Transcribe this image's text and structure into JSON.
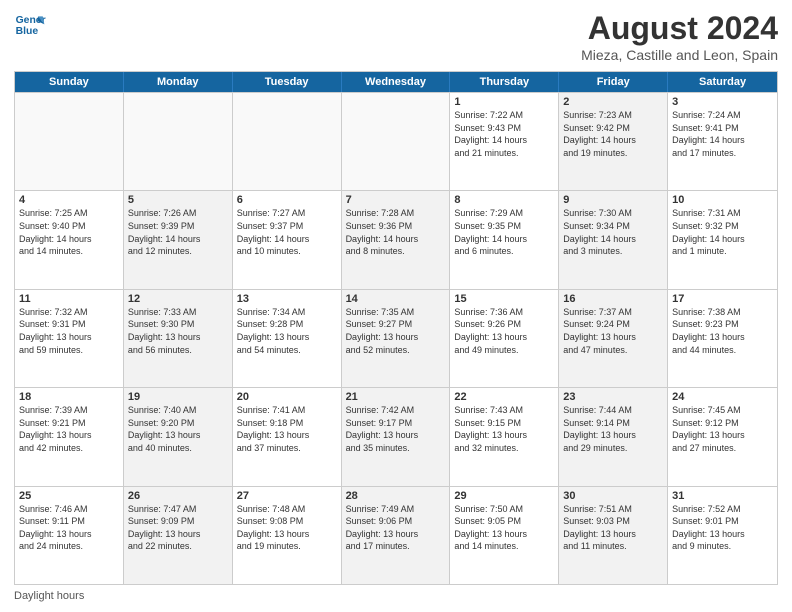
{
  "logo": {
    "line1": "General",
    "line2": "Blue"
  },
  "title": "August 2024",
  "subtitle": "Mieza, Castille and Leon, Spain",
  "days_of_week": [
    "Sunday",
    "Monday",
    "Tuesday",
    "Wednesday",
    "Thursday",
    "Friday",
    "Saturday"
  ],
  "weeks": [
    [
      {
        "day": "",
        "info": "",
        "empty": true
      },
      {
        "day": "",
        "info": "",
        "empty": true
      },
      {
        "day": "",
        "info": "",
        "empty": true
      },
      {
        "day": "",
        "info": "",
        "empty": true
      },
      {
        "day": "1",
        "info": "Sunrise: 7:22 AM\nSunset: 9:43 PM\nDaylight: 14 hours\nand 21 minutes."
      },
      {
        "day": "2",
        "info": "Sunrise: 7:23 AM\nSunset: 9:42 PM\nDaylight: 14 hours\nand 19 minutes.",
        "shaded": true
      },
      {
        "day": "3",
        "info": "Sunrise: 7:24 AM\nSunset: 9:41 PM\nDaylight: 14 hours\nand 17 minutes."
      }
    ],
    [
      {
        "day": "4",
        "info": "Sunrise: 7:25 AM\nSunset: 9:40 PM\nDaylight: 14 hours\nand 14 minutes."
      },
      {
        "day": "5",
        "info": "Sunrise: 7:26 AM\nSunset: 9:39 PM\nDaylight: 14 hours\nand 12 minutes.",
        "shaded": true
      },
      {
        "day": "6",
        "info": "Sunrise: 7:27 AM\nSunset: 9:37 PM\nDaylight: 14 hours\nand 10 minutes."
      },
      {
        "day": "7",
        "info": "Sunrise: 7:28 AM\nSunset: 9:36 PM\nDaylight: 14 hours\nand 8 minutes.",
        "shaded": true
      },
      {
        "day": "8",
        "info": "Sunrise: 7:29 AM\nSunset: 9:35 PM\nDaylight: 14 hours\nand 6 minutes."
      },
      {
        "day": "9",
        "info": "Sunrise: 7:30 AM\nSunset: 9:34 PM\nDaylight: 14 hours\nand 3 minutes.",
        "shaded": true
      },
      {
        "day": "10",
        "info": "Sunrise: 7:31 AM\nSunset: 9:32 PM\nDaylight: 14 hours\nand 1 minute."
      }
    ],
    [
      {
        "day": "11",
        "info": "Sunrise: 7:32 AM\nSunset: 9:31 PM\nDaylight: 13 hours\nand 59 minutes."
      },
      {
        "day": "12",
        "info": "Sunrise: 7:33 AM\nSunset: 9:30 PM\nDaylight: 13 hours\nand 56 minutes.",
        "shaded": true
      },
      {
        "day": "13",
        "info": "Sunrise: 7:34 AM\nSunset: 9:28 PM\nDaylight: 13 hours\nand 54 minutes."
      },
      {
        "day": "14",
        "info": "Sunrise: 7:35 AM\nSunset: 9:27 PM\nDaylight: 13 hours\nand 52 minutes.",
        "shaded": true
      },
      {
        "day": "15",
        "info": "Sunrise: 7:36 AM\nSunset: 9:26 PM\nDaylight: 13 hours\nand 49 minutes."
      },
      {
        "day": "16",
        "info": "Sunrise: 7:37 AM\nSunset: 9:24 PM\nDaylight: 13 hours\nand 47 minutes.",
        "shaded": true
      },
      {
        "day": "17",
        "info": "Sunrise: 7:38 AM\nSunset: 9:23 PM\nDaylight: 13 hours\nand 44 minutes."
      }
    ],
    [
      {
        "day": "18",
        "info": "Sunrise: 7:39 AM\nSunset: 9:21 PM\nDaylight: 13 hours\nand 42 minutes."
      },
      {
        "day": "19",
        "info": "Sunrise: 7:40 AM\nSunset: 9:20 PM\nDaylight: 13 hours\nand 40 minutes.",
        "shaded": true
      },
      {
        "day": "20",
        "info": "Sunrise: 7:41 AM\nSunset: 9:18 PM\nDaylight: 13 hours\nand 37 minutes."
      },
      {
        "day": "21",
        "info": "Sunrise: 7:42 AM\nSunset: 9:17 PM\nDaylight: 13 hours\nand 35 minutes.",
        "shaded": true
      },
      {
        "day": "22",
        "info": "Sunrise: 7:43 AM\nSunset: 9:15 PM\nDaylight: 13 hours\nand 32 minutes."
      },
      {
        "day": "23",
        "info": "Sunrise: 7:44 AM\nSunset: 9:14 PM\nDaylight: 13 hours\nand 29 minutes.",
        "shaded": true
      },
      {
        "day": "24",
        "info": "Sunrise: 7:45 AM\nSunset: 9:12 PM\nDaylight: 13 hours\nand 27 minutes."
      }
    ],
    [
      {
        "day": "25",
        "info": "Sunrise: 7:46 AM\nSunset: 9:11 PM\nDaylight: 13 hours\nand 24 minutes."
      },
      {
        "day": "26",
        "info": "Sunrise: 7:47 AM\nSunset: 9:09 PM\nDaylight: 13 hours\nand 22 minutes.",
        "shaded": true
      },
      {
        "day": "27",
        "info": "Sunrise: 7:48 AM\nSunset: 9:08 PM\nDaylight: 13 hours\nand 19 minutes."
      },
      {
        "day": "28",
        "info": "Sunrise: 7:49 AM\nSunset: 9:06 PM\nDaylight: 13 hours\nand 17 minutes.",
        "shaded": true
      },
      {
        "day": "29",
        "info": "Sunrise: 7:50 AM\nSunset: 9:05 PM\nDaylight: 13 hours\nand 14 minutes."
      },
      {
        "day": "30",
        "info": "Sunrise: 7:51 AM\nSunset: 9:03 PM\nDaylight: 13 hours\nand 11 minutes.",
        "shaded": true
      },
      {
        "day": "31",
        "info": "Sunrise: 7:52 AM\nSunset: 9:01 PM\nDaylight: 13 hours\nand 9 minutes."
      }
    ]
  ],
  "footer": "Daylight hours"
}
